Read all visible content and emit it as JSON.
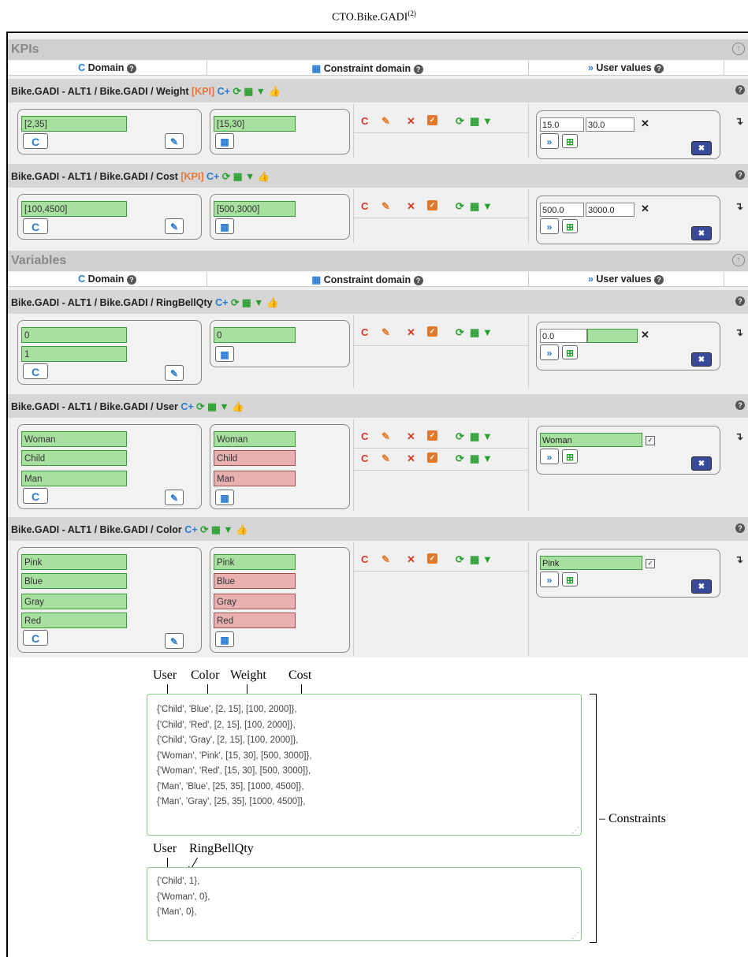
{
  "figure_title": "CTO.Bike.GADI",
  "figure_title_sup": "(2)",
  "kpis_section": {
    "label": "KPIs"
  },
  "variables_section": {
    "label": "Variables"
  },
  "columns": {
    "domain": "Domain",
    "constraint_domain": "Constraint domain",
    "user_values": "User values"
  },
  "kpi_tag": "[KPI]",
  "rows": [
    {
      "path": "Bike.GADI - ALT1 / Bike.GADI / Weight",
      "domain": [
        "[2,35]"
      ],
      "constraint": [
        "[15,30]"
      ],
      "user_values": [
        "15.0",
        "30.0"
      ]
    },
    {
      "path": "Bike.GADI - ALT1 / Bike.GADI / Cost",
      "domain": [
        "[100,4500]"
      ],
      "constraint": [
        "[500,3000]"
      ],
      "user_values": [
        "500.0",
        "3000.0"
      ]
    },
    {
      "path": "Bike.GADI - ALT1 / Bike.GADI / RingBellQty",
      "domain": [
        "0",
        "1"
      ],
      "constraint": [
        "0"
      ],
      "user_values": [
        "0.0"
      ]
    },
    {
      "path": "Bike.GADI - ALT1 / Bike.GADI / User",
      "domain": [
        "Woman",
        "Child",
        "Man"
      ],
      "constraint": [
        "Woman",
        "Child",
        "Man"
      ],
      "user_values": [
        "Woman"
      ]
    },
    {
      "path": "Bike.GADI - ALT1 / Bike.GADI / Color",
      "domain": [
        "Pink",
        "Blue",
        "Gray",
        "Red"
      ],
      "constraint": [
        "Pink",
        "Blue",
        "Gray",
        "Red"
      ],
      "user_values": [
        "Pink"
      ]
    }
  ],
  "annotations": {
    "labels1": [
      "User",
      "Color",
      "Weight",
      "Cost"
    ],
    "labels2": [
      "User",
      "RingBellQty"
    ],
    "constraints_label": "Constraints"
  },
  "textarea1": [
    "{'Child', 'Blue', [2, 15], [100, 2000]},",
    "{'Child', 'Red', [2, 15], [100, 2000]},",
    "{'Child', 'Gray', [2, 15], [100, 2000]},",
    "{'Woman', 'Pink', [15, 30], [500, 3000]},",
    "{'Woman', 'Red', [15, 30], [500, 3000]},",
    "{'Man', 'Blue', [25, 35], [1000, 4500]},",
    "{'Man', 'Gray', [25, 35], [1000, 4500]},"
  ],
  "textarea2": [
    "{'Child', 1},",
    "{'Woman', 0},",
    "{'Man', 0},"
  ],
  "icons": {
    "refresh": "C",
    "calc": "▦",
    "chevron": "»",
    "plus_box": "⊞",
    "close_box": "✖",
    "expand_up": "⊕",
    "row_arrow": "↴"
  }
}
